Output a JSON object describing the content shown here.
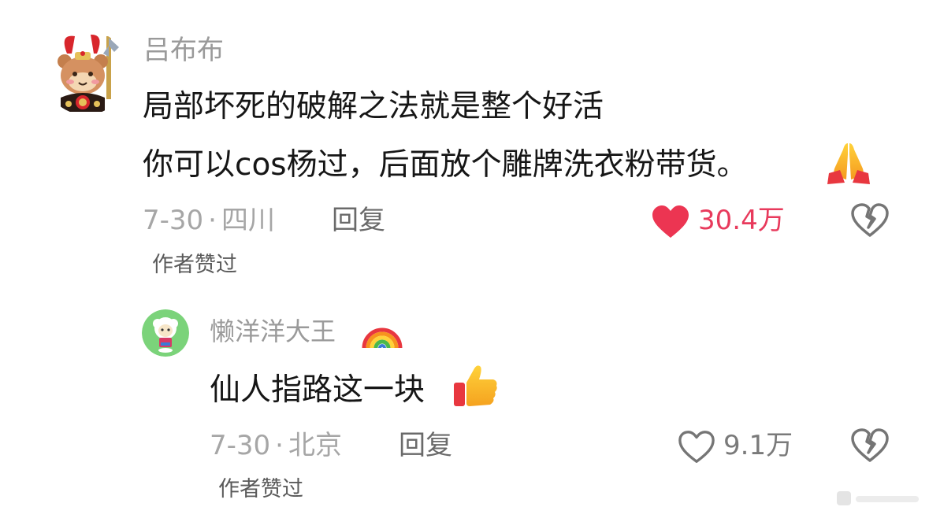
{
  "comments": [
    {
      "username": "吕布布",
      "lines": [
        "局部坏死的破解之法就是整个好活",
        "你可以cos杨过，后面放个雕牌洗衣粉带货。"
      ],
      "date": "7-30",
      "location": "四川",
      "reply_label": "回复",
      "like_count": "30.4万",
      "liked": true,
      "author_liked": "作者赞过",
      "avatar_icon": "bear-warrior-avatar-icon",
      "emoji_icon": "folded-hands-emoji-icon"
    },
    {
      "username": "懒洋洋大王",
      "lines": [
        "仙人指路这一块"
      ],
      "date": "7-30",
      "location": "北京",
      "reply_label": "回复",
      "like_count": "9.1万",
      "liked": false,
      "author_liked": "作者赞过",
      "avatar_icon": "lazy-sheep-avatar-icon",
      "badge_icon": "rainbow-emoji-icon",
      "emoji_icon": "thumbs-up-emoji-icon"
    }
  ],
  "colors": {
    "like_active": "#e83a5c",
    "text_primary": "#161616",
    "text_secondary": "#9a9a9a"
  }
}
